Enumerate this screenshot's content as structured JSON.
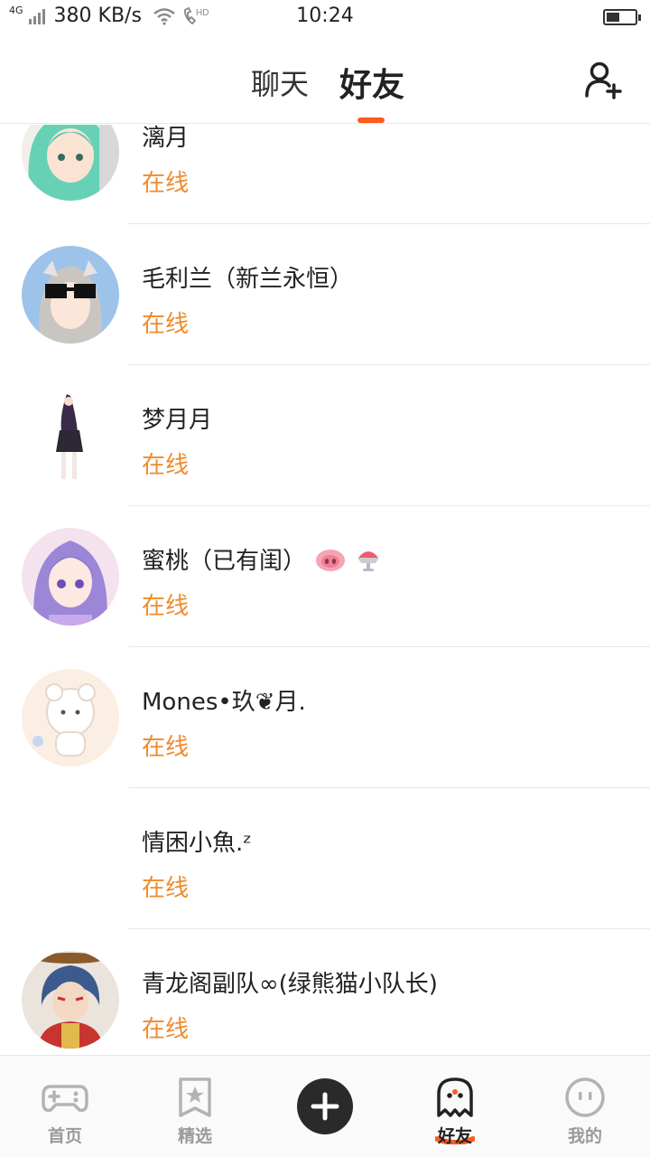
{
  "status_bar": {
    "network": "4G",
    "speed": "380 KB/s",
    "time": "10:24",
    "hd_label": "HD",
    "battery_level": 0.45
  },
  "header": {
    "tabs": [
      {
        "label": "聊天"
      },
      {
        "label": "好友"
      }
    ],
    "active_tab": "好友",
    "add_friend_icon": "add-person-icon",
    "accent_color": "#ff5a1f"
  },
  "friends": [
    {
      "name": "漓月",
      "status": "在线",
      "avatar": "anime-girl-green-hair"
    },
    {
      "name": "毛利兰（新兰永恒）",
      "status": "在线",
      "avatar": "anime-girl-sunglasses"
    },
    {
      "name": "梦月月",
      "status": "在线",
      "avatar": "anime-figure-standing"
    },
    {
      "name": "蜜桃（已有闺）",
      "status": "在线",
      "avatar": "anime-girl-purple-hair"
    },
    {
      "name": "Mones•玖❦月.",
      "status": "在线",
      "avatar": "bear-sticker"
    },
    {
      "name": "情困小魚.ᶻ",
      "status": "在线",
      "avatar": "none"
    },
    {
      "name": "青龙阁副队∞(绿熊猫小队长)",
      "status": "在线",
      "avatar": "anime-warrior-red"
    }
  ],
  "status_color": "#f08a2c",
  "bottom_nav": {
    "items": [
      {
        "label": "首页",
        "icon": "gamepad-icon"
      },
      {
        "label": "精选",
        "icon": "bookmark-star-icon"
      },
      {
        "label": "",
        "icon": "plus-icon"
      },
      {
        "label": "好友",
        "icon": "ghost-icon"
      },
      {
        "label": "我的",
        "icon": "face-icon"
      }
    ],
    "active": "好友"
  }
}
